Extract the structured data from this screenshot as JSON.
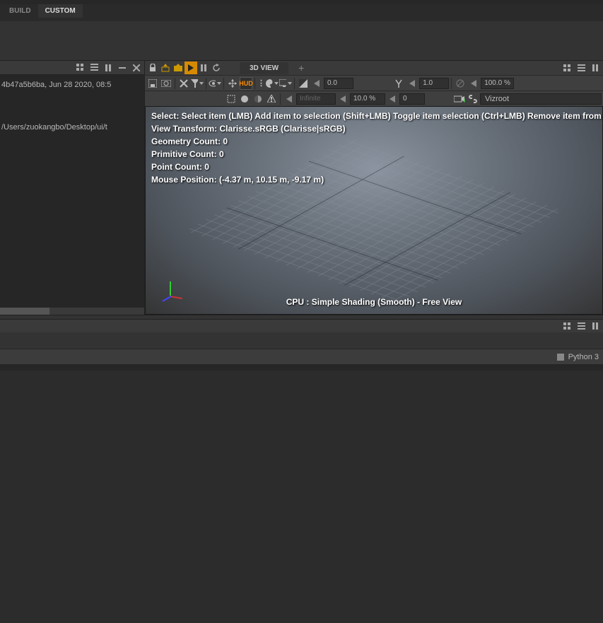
{
  "top_tabs": {
    "build": "BUILD",
    "custom": "CUSTOM",
    "active": "custom"
  },
  "console": {
    "line1": "4b47a5b6ba, Jun 28 2020, 08:5",
    "line3": "/Users/zuokangbo/Desktop/ui/t"
  },
  "viewer": {
    "tab_label": "3D VIEW",
    "tab_add": "+",
    "toolbar1": {
      "num_a": "0.0",
      "num_b": "1.0",
      "num_c": "100.0 %"
    },
    "toolbar2": {
      "near_label": "Infinite",
      "near_pct": "10.0 %",
      "far": "0",
      "camera": "Vizroot"
    },
    "overlay": {
      "select_hint": "Select: Select item (LMB)  Add item to selection (Shift+LMB)  Toggle item selection (Ctrl+LMB)  Remove item from sel",
      "view_transform": "View Transform: Clarisse.sRGB (Clarisse|sRGB)",
      "geo_count": "Geometry Count: 0",
      "prim_count": "Primitive Count: 0",
      "point_count": "Point Count: 0",
      "mouse_pos": "Mouse Position:  (-4.37 m, 10.15 m, -9.17 m)",
      "render_mode": "CPU : Simple Shading (Smooth) - Free View"
    }
  },
  "python_panel": {
    "lang": "Python 3"
  },
  "icons": {
    "hud": "HUD"
  }
}
